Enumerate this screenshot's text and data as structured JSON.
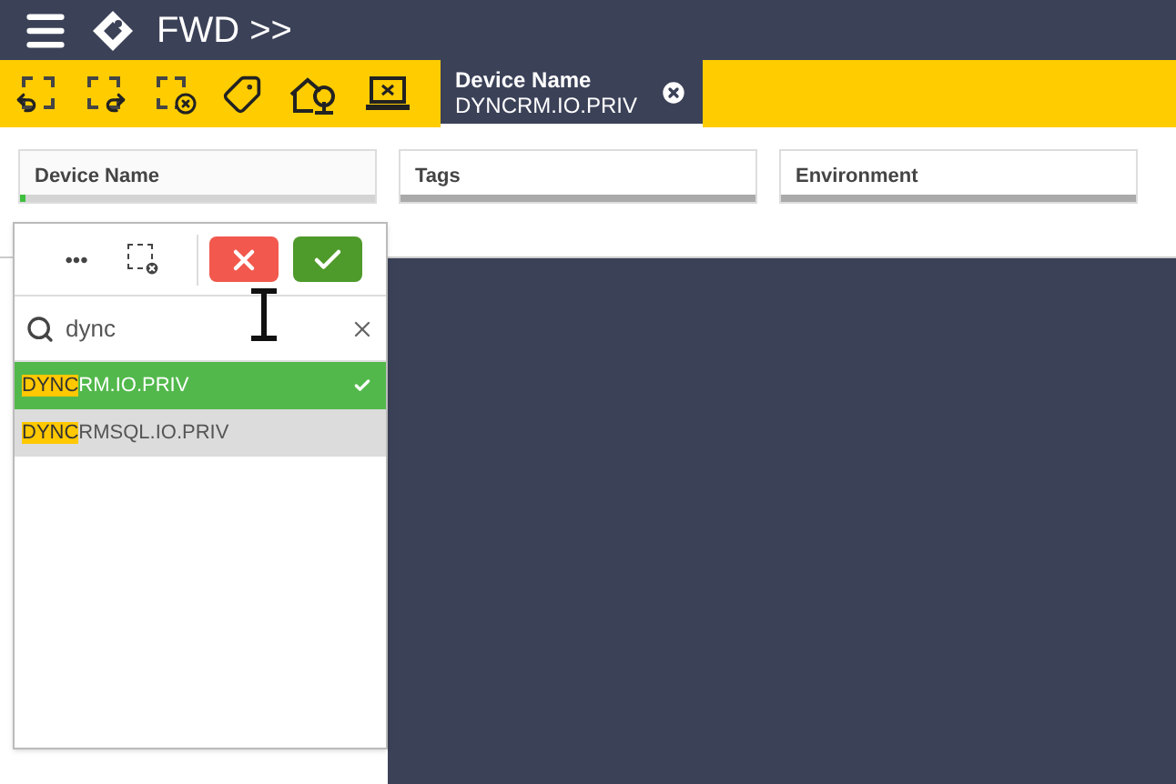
{
  "app_title": "FWD >>",
  "toolbar": {
    "selection_tab": {
      "label": "Device Name",
      "value": "DYNCRM.IO.PRIV"
    }
  },
  "filters": [
    {
      "label": "Device Name",
      "active": true
    },
    {
      "label": "Tags",
      "active": false
    },
    {
      "label": "Environment",
      "active": false
    }
  ],
  "popup": {
    "more": "•••",
    "search": {
      "value": "dync"
    },
    "items": [
      {
        "match": "DYNC",
        "rest": "RM.IO.PRIV",
        "selected": true
      },
      {
        "match": "DYNC",
        "rest": "RMSQL.IO.PRIV",
        "selected": false
      }
    ]
  }
}
